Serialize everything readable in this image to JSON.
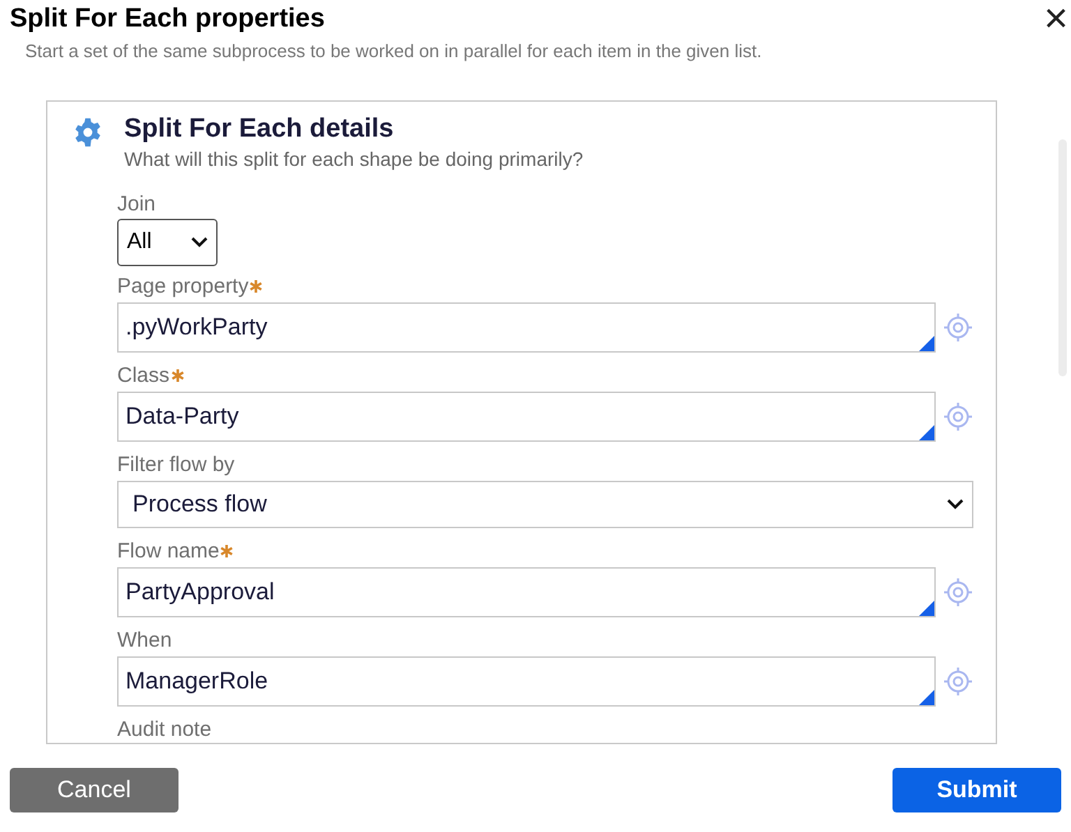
{
  "dialog": {
    "title": "Split For Each properties",
    "close": "×"
  },
  "intro": "Start a set of the same subprocess to be worked on in parallel for each item in the given list.",
  "section": {
    "title": "Split For Each details",
    "subtitle": "What will this split for each shape be doing primarily?"
  },
  "fields": [
    {
      "kind": "small-select",
      "label": "Join",
      "required": false,
      "value": "All"
    },
    {
      "kind": "text",
      "label": "Page property",
      "required": true,
      "value": ".pyWorkParty"
    },
    {
      "kind": "text",
      "label": "Class",
      "required": true,
      "value": "Data-Party"
    },
    {
      "kind": "select",
      "label": "Filter flow by",
      "required": false,
      "value": "Process flow"
    },
    {
      "kind": "text",
      "label": "Flow name",
      "required": true,
      "value": "PartyApproval"
    },
    {
      "kind": "text",
      "label": "When",
      "required": false,
      "value": "ManagerRole"
    },
    {
      "kind": "label-only",
      "label": "Audit note",
      "required": false
    }
  ],
  "buttons": [
    {
      "kind": "secondary",
      "label": "Cancel"
    },
    {
      "kind": "primary",
      "label": "Submit"
    }
  ]
}
